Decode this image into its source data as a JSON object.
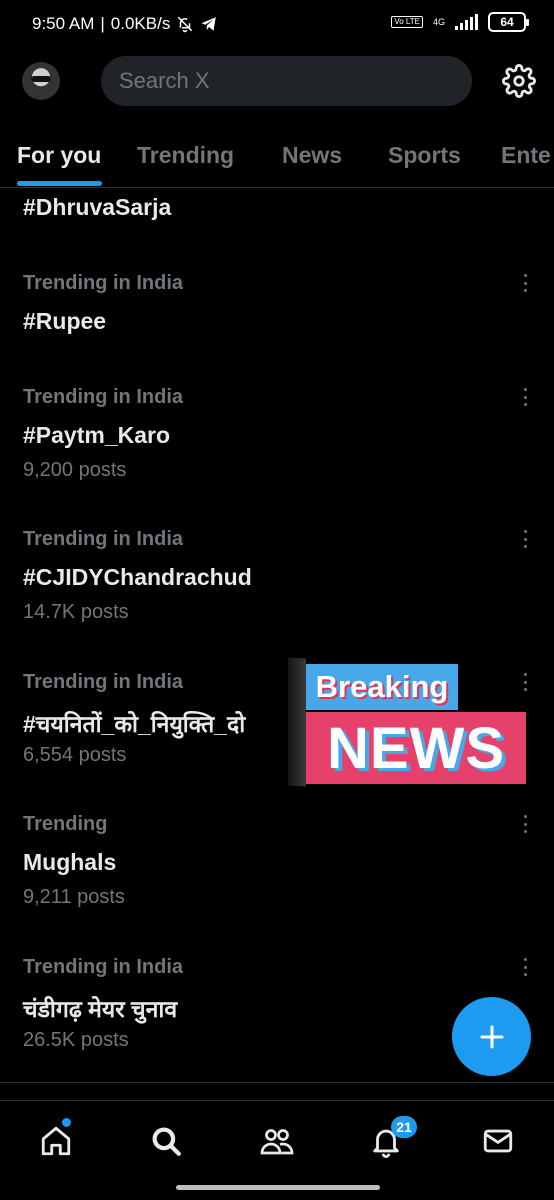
{
  "status_bar": {
    "time": "9:50 AM",
    "network_speed": "0.0KB/s",
    "volte": "Vo LTE",
    "network_type": "4G",
    "battery": "64"
  },
  "header": {
    "search_placeholder": "Search X",
    "avatar_icon": "avatar",
    "settings_icon": "gear-icon"
  },
  "tabs": [
    {
      "label": "For you",
      "active": true
    },
    {
      "label": "Trending",
      "active": false
    },
    {
      "label": "News",
      "active": false
    },
    {
      "label": "Sports",
      "active": false
    },
    {
      "label": "Ente",
      "active": false
    }
  ],
  "trends": [
    {
      "category": "",
      "name": "#DhruvaSarja",
      "posts": ""
    },
    {
      "category": "Trending in India",
      "name": "#Rupee",
      "posts": ""
    },
    {
      "category": "Trending in India",
      "name": "#Paytm_Karo",
      "posts": "9,200 posts"
    },
    {
      "category": "Trending in India",
      "name": "#CJIDYChandrachud",
      "posts": "14.7K posts"
    },
    {
      "category": "Trending in India",
      "name": "#चयनितों_को_नियुक्ति_दो",
      "posts": "6,554 posts"
    },
    {
      "category": "Trending",
      "name": "Mughals",
      "posts": "9,211 posts"
    },
    {
      "category": "Trending in India",
      "name": "चंडीगढ़ मेयर चुनाव",
      "posts": "26.5K posts"
    }
  ],
  "sticker": {
    "line1": "Breaking",
    "line2": "NEWS"
  },
  "fab": {
    "icon": "plus-icon"
  },
  "bottom_nav": {
    "items": [
      "home-icon",
      "search-icon",
      "communities-icon",
      "notifications-icon",
      "messages-icon"
    ],
    "notifications_badge": "21"
  },
  "colors": {
    "accent": "#1d9bf0",
    "background": "#000000",
    "secondary_text": "#71767b",
    "sticker_blue": "#48a7e8",
    "sticker_red": "#e5416a"
  }
}
